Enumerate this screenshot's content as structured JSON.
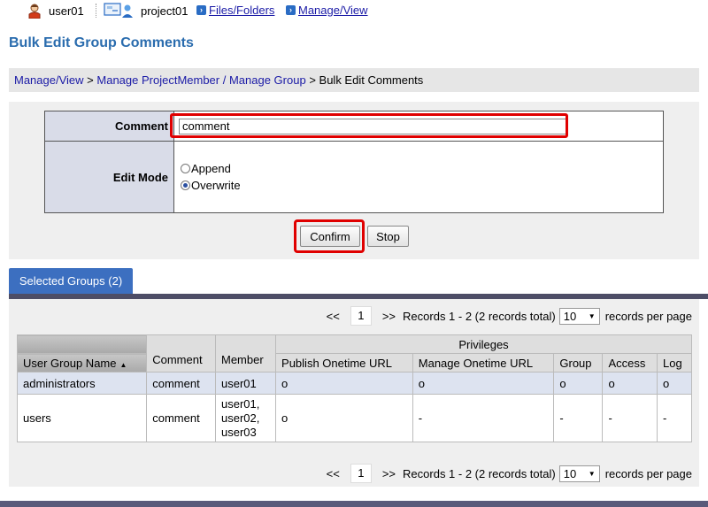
{
  "topbar": {
    "user": "user01",
    "project": "project01",
    "links": [
      "Files/Folders",
      "Manage/View"
    ]
  },
  "page_title": "Bulk Edit Group Comments",
  "breadcrumb": {
    "items": [
      "Manage/View",
      "Manage ProjectMember / Manage Group"
    ],
    "separator": ">",
    "current": "Bulk Edit Comments"
  },
  "form": {
    "comment_label": "Comment",
    "comment_value": "comment",
    "edit_mode_label": "Edit Mode",
    "mode_options": [
      "Append",
      "Overwrite"
    ],
    "mode_selected": "Overwrite",
    "confirm_label": "Confirm",
    "stop_label": "Stop"
  },
  "tab": {
    "label": "Selected Groups (2)"
  },
  "pager": {
    "prev": "<<",
    "page": "1",
    "next": ">>",
    "records_text": "Records 1 - 2 (2 records total)",
    "per_page": "10",
    "per_page_suffix": "records per page"
  },
  "grid": {
    "group_header": "Privileges",
    "columns": [
      "User Group Name",
      "Comment",
      "Member",
      "Publish Onetime URL",
      "Manage Onetime URL",
      "Group",
      "Access",
      "Log"
    ],
    "rows": [
      [
        "administrators",
        "comment",
        "user01",
        "o",
        "o",
        "o",
        "o",
        "o"
      ],
      [
        "users",
        "comment",
        "user01,\nuser02,\nuser03",
        "o",
        "-",
        "-",
        "-",
        "-"
      ]
    ]
  },
  "colors": {
    "title": "#2a6cae",
    "tab": "#3c6fc0",
    "highlight": "#e00000"
  }
}
